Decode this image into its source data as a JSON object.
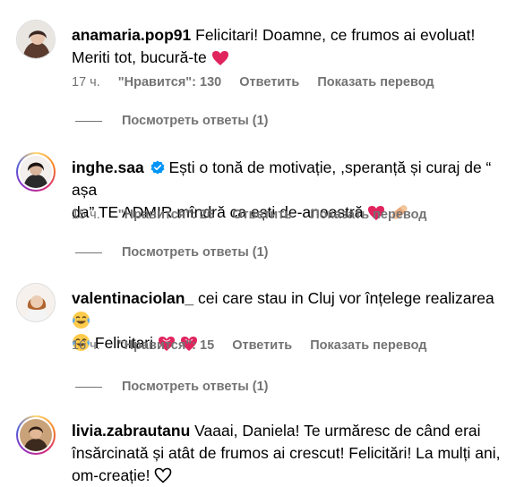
{
  "comments": [
    {
      "username": "anamaria.pop91",
      "text": "Felicitari! Doamne, ce frumos ai evoluat! Meriti tot, bucură-te",
      "time": "17 ч.",
      "likes": "\"Нравится\": 130",
      "reply": "Ответить",
      "translate": "Показать перевод",
      "view_replies": "Посмотреть ответы (1)"
    },
    {
      "username": "inghe.saa",
      "text_line1": "Ești o tonă de motivație, ,speranță și curaj de “ așa",
      "text_line2": "da” TE ADMIR mîndră ca ești de-anoastră",
      "time": "15 ч.",
      "likes": "\"Нравится\": 26",
      "reply": "Ответить",
      "translate": "Показать перевод",
      "view_replies": "Посмотреть ответы (1)"
    },
    {
      "username": "valentinaciolan_",
      "text_line1": "cei care stau in Cluj vor înțelege realizarea",
      "text_line2": "Felicitari",
      "time": "16 ч.",
      "likes": "\"Нравится\": 15",
      "reply": "Ответить",
      "translate": "Показать перевод",
      "view_replies": "Посмотреть ответы (1)"
    },
    {
      "username": "livia.zabrautanu",
      "text_line1": "Vaaai, Daniela! Te urmăresc de când erai",
      "text_line2": "însărcinată și atât de frumos ai crescut! Felicitări! La mulți ani,",
      "text_line3": "om-creație!"
    }
  ],
  "colors": {
    "meta": "#737373",
    "heart": "#e0245e",
    "verified": "#0095f6"
  },
  "icons": [
    "verified-badge-icon",
    "red-heart-icon",
    "bandage-icon",
    "joy-emoji-icon",
    "heart-outline-icon"
  ]
}
